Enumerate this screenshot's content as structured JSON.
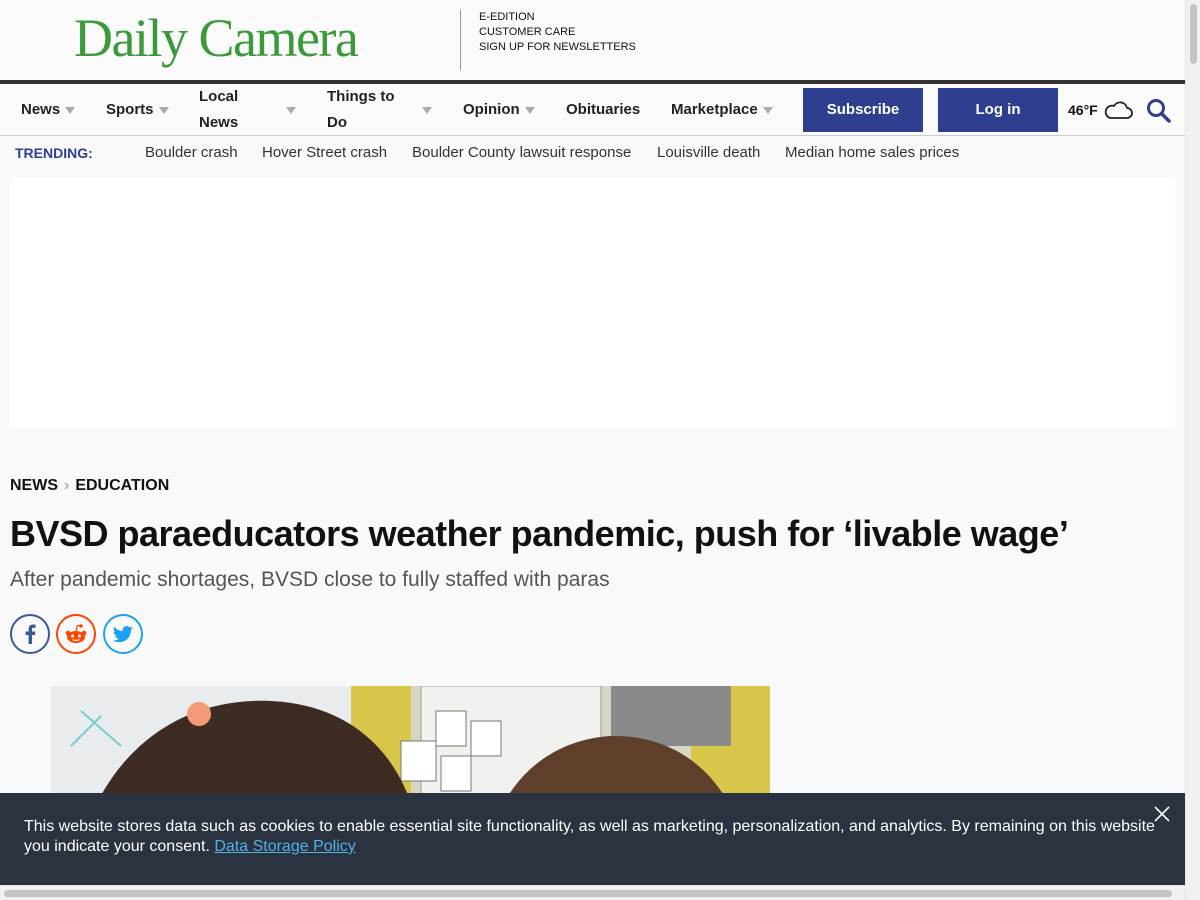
{
  "header": {
    "logo": "Daily Camera",
    "utility_links": [
      "E-EDITION",
      "CUSTOMER CARE",
      "SIGN UP FOR NEWSLETTERS"
    ]
  },
  "nav": {
    "items": [
      {
        "label": "News"
      },
      {
        "label": "Sports"
      },
      {
        "label_line1": "Local",
        "label_line2": "News"
      },
      {
        "label_line1": "Things to",
        "label_line2": "Do"
      },
      {
        "label": "Opinion"
      },
      {
        "label": "Obituaries"
      },
      {
        "label": "Marketplace"
      }
    ],
    "subscribe_label": "Subscribe",
    "login_label": "Log in",
    "weather_temp": "46°F",
    "weather_icon": "cloud-icon",
    "search_icon": "search-icon",
    "accent_color": "#2e3f8f"
  },
  "trending": {
    "label": "TRENDING:",
    "topics": [
      "Boulder crash",
      "Hover Street crash",
      "Boulder County lawsuit response",
      "Louisville death",
      "Median home sales prices"
    ]
  },
  "article": {
    "breadcrumb": [
      "NEWS",
      "EDUCATION"
    ],
    "headline": "BVSD paraeducators weather pandemic, push for ‘livable wage’",
    "subheadline": "After pandemic shortages, BVSD close to fully staffed with paras",
    "share_icons": [
      "facebook-icon",
      "reddit-icon",
      "twitter-icon"
    ]
  },
  "cookie_banner": {
    "text": "This website stores data such as cookies to enable essential site functionality, as well as marketing, personalization, and analytics. By remaining on this website you indicate your consent.",
    "link_label": "Data Storage Policy"
  },
  "colors": {
    "brand_green": "#3c9a3c",
    "facebook": "#3b5998",
    "reddit": "#ff4500",
    "twitter": "#1da1f2"
  }
}
